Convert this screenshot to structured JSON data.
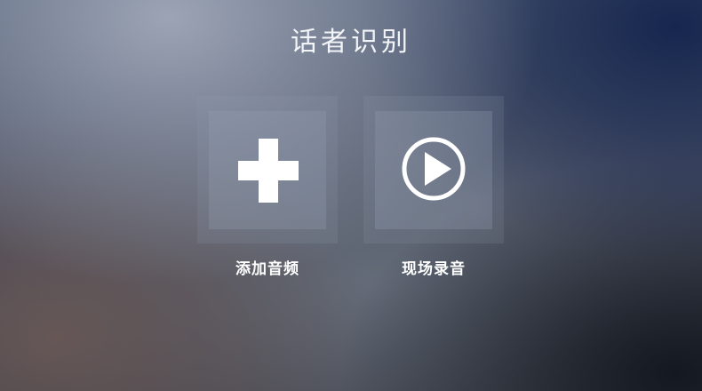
{
  "page": {
    "title": "话者识别"
  },
  "actions": [
    {
      "label": "添加音频",
      "icon": "plus-icon"
    },
    {
      "label": "现场录音",
      "icon": "play-circle-icon"
    }
  ],
  "colors": {
    "icon": "#ffffff",
    "text": "#ffffff"
  }
}
